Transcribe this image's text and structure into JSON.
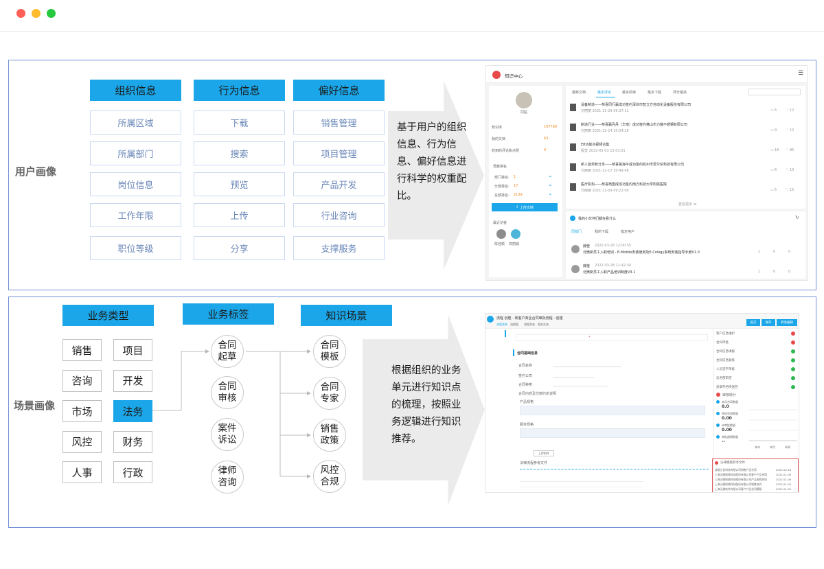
{
  "window": {
    "dots": [
      "#fe5f57",
      "#febc2e",
      "#28c840"
    ]
  },
  "section1": {
    "label": "用户画像",
    "headers": [
      "组织信息",
      "行为信息",
      "偏好信息"
    ],
    "columns": [
      [
        "所属区域",
        "所属部门",
        "岗位信息",
        "工作年限",
        "职位等级"
      ],
      [
        "下载",
        "搜索",
        "预览",
        "上传",
        "分享"
      ],
      [
        "销售管理",
        "项目管理",
        "产品开发",
        "行业咨询",
        "支撑服务"
      ]
    ],
    "arrow_text": "基于用户的组织信息、行为信息、偏好信息进行科学的权重配比。",
    "screenshot": {
      "title": "知识中心",
      "username": "同贴",
      "stats": [
        {
          "label": "知识库",
          "value": "197780"
        },
        {
          "label": "我的文档",
          "value": "63"
        },
        {
          "label": "收到的评论和点赞",
          "value": "0"
        }
      ],
      "rank_title": "贡献排名",
      "ranks": [
        {
          "label": "部门排名:",
          "value": "1"
        },
        {
          "label": "分部排名:",
          "value": "17"
        },
        {
          "label": "总部排名:",
          "value": "2139"
        }
      ],
      "upload_button": "上传文档",
      "visitor_title": "最近访者",
      "visitors": [
        "陈佳颖",
        "高丽娟"
      ],
      "tabs": [
        "最新文档",
        "最多评论",
        "最多阅读",
        "最多下载",
        "评分最高"
      ],
      "docs": [
        {
          "title": "设备制造——恭喜同行赢成功签约深圳市智立方自动化设备股份有限公司",
          "meta": "刘丽丽  2021-11-29 09:37:11",
          "c": "6",
          "l": "12"
        },
        {
          "title": "制造行业——恭喜赢丹丹（华南）成功签约佛山市力盛不锈钢有限公司",
          "meta": "刘丽丽  2021-12-14 10:04:28",
          "c": "9",
          "l": "12"
        },
        {
          "title": "E8功能点视频合集",
          "meta": "殷莹  2022-03-03 15:01:01",
          "c": "18",
          "l": "85"
        },
        {
          "title": "新人首单积分享——恭喜姚海平成功签约杭州市爱尔伦科技有限公司",
          "meta": "刘丽丽  2021-12-17 10:49:48",
          "c": "6",
          "l": "10"
        },
        {
          "title": "医疗机构——恭喜杨国成成功签约南方科技大学附属医院",
          "meta": "刘丽丽  2021-11-09 09:22:00",
          "c": "5",
          "l": "15"
        }
      ],
      "more": "查看更多 ≫",
      "partner_title": "我的小伙伴们都在看什么",
      "partner_tabs": [
        "同部门",
        "我的下属",
        "指定用户"
      ],
      "feeds": [
        {
          "name": "薛莹",
          "time": "2022-03-28 12:00:55",
          "text": "泛微新员工入职培训 - E-Mobile安装使用及E-Cology系统安装指导手册V1.0",
          "a": "1",
          "b": "0",
          "c": "0"
        },
        {
          "name": "薛莹",
          "time": "2022-03-28 11:42:34",
          "text": "泛微新员工入职产品培训制度V3.1",
          "a": "1",
          "b": "0",
          "c": "0"
        }
      ]
    }
  },
  "section2": {
    "label": "场景画像",
    "headers": [
      "业务类型",
      "业务标签",
      "知识场景"
    ],
    "types": [
      "销售",
      "项目",
      "咨询",
      "开发",
      "市场",
      "法务",
      "风控",
      "财务",
      "人事",
      "行政"
    ],
    "labels": [
      "合同起草",
      "合同审核",
      "案件诉讼",
      "律师咨询"
    ],
    "scenes": [
      "合同模板",
      "合同专家",
      "销售政策",
      "风控合规"
    ],
    "arrow_text": "根据组织的业务单元进行知识点的梳理，按照业务逻辑进行知识推荐。",
    "screenshot": {
      "title": "流程 创建 - 新客户商业合同审批流程 - 创建",
      "form_tabs": [
        "流程表单",
        "流程图",
        "流程状态",
        "相关交流"
      ],
      "buttons": [
        "提交",
        "保存",
        "转发编辑"
      ],
      "section_title": "合同基础信息",
      "fields": [
        "合同名称",
        "签约公司",
        "合同种类",
        "合同内容及付款约定说明"
      ],
      "tables": [
        "产品规格",
        "服务规格"
      ],
      "upload": "上传附件",
      "ref_title": "法律流程参考文件",
      "check_items": [
        "客户信息维护",
        "合同审批",
        "合同信息填报",
        "合同信息复核",
        "人员签字审核",
        "法务部审定",
        "盖章存档待送回"
      ],
      "stats_title": "审核统计",
      "stats": [
        {
          "label": "本月合同数量",
          "value": "0.0"
        },
        {
          "label": "审核完成数量",
          "value": "0.00"
        },
        {
          "label": "未审批数量",
          "value": "0.00"
        },
        {
          "label": "审批超期数量",
          "value": "--"
        }
      ],
      "chart_axis": [
        "本年",
        "本月",
        "本周"
      ],
      "ref_files_title": "法律模版参考文件",
      "ref_files": [
        {
          "name": "成都立信科技有限公司销售产品合同",
          "date": "2022-02-28"
        },
        {
          "name": "上海泛微网络科技股份有限公司客户产品合同",
          "date": "2022-01-06"
        },
        {
          "name": "上海泛微网络科技股份有限公司产品采购合同",
          "date": "2022-01-06"
        },
        {
          "name": "上海泛微网络科技股份有限公司销售合同",
          "date": "2022-01-05"
        },
        {
          "name": "上海泛微软件有限公司客户产品合同模版",
          "date": "2022-01-05"
        }
      ]
    }
  },
  "colors": {
    "accent": "#1aa6e8",
    "panel_border": "#6f8fd6",
    "cell_text": "#6a87b8",
    "red": "#e84a4a",
    "green": "#2fb84f"
  }
}
